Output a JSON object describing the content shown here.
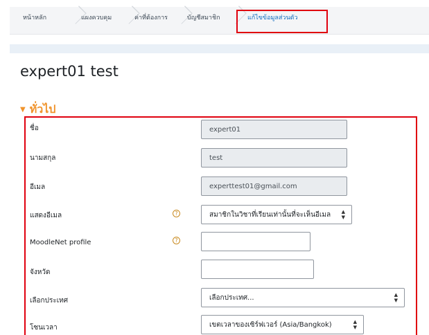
{
  "breadcrumb": {
    "items": [
      "หน้าหลัก",
      "แผงควบคุม",
      "ค่าที่ต้องการ",
      "บัญชีสมาชิก",
      "แก้ไขข้อมูลส่วนตัว"
    ]
  },
  "page": {
    "title": "expert01 test"
  },
  "section": {
    "title": "ทั่วไป"
  },
  "form": {
    "first_name": {
      "label": "ชื่อ",
      "value": "expert01"
    },
    "last_name": {
      "label": "นามสกุล",
      "value": "test"
    },
    "email": {
      "label": "อีเมล",
      "value": "experttest01@gmail.com"
    },
    "email_display": {
      "label": "แสดงอีเมล",
      "value": "สมาชิกในวิชาที่เรียนเท่านั้นที่จะเห็นอีเมล"
    },
    "moodlenet": {
      "label": "MoodleNet profile",
      "value": ""
    },
    "city": {
      "label": "จังหวัด",
      "value": ""
    },
    "country": {
      "label": "เลือกประเทศ",
      "value": "เลือกประเทศ..."
    },
    "timezone": {
      "label": "โซนเวลา",
      "value": "เขตเวลาของเซิร์ฟเวอร์ (Asia/Bangkok)"
    }
  },
  "icons": {
    "help": "question-circle-icon",
    "select_arrow": "sort-arrows-icon",
    "section_toggle": "chevron-down-icon"
  },
  "colors": {
    "highlight_border": "#e0000e",
    "section_title": "#f0932b",
    "help_icon": "#c98a1f",
    "link": "#0f6cbf"
  }
}
